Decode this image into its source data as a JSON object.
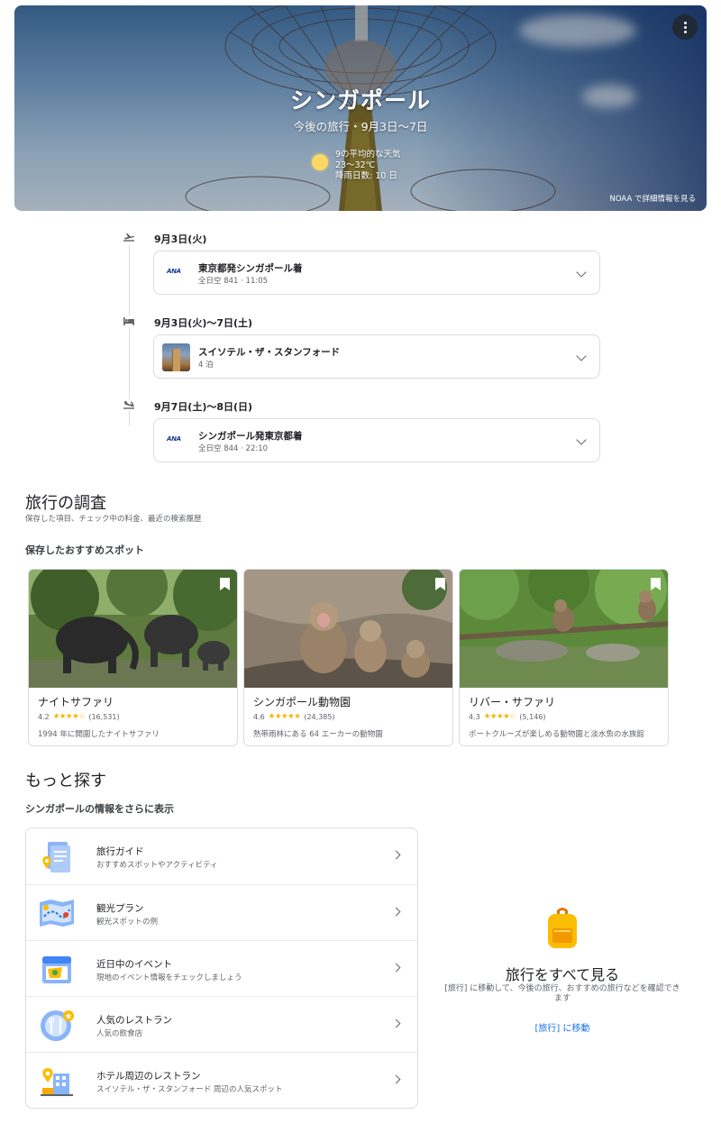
{
  "hero": {
    "title": "シンガポール",
    "subtitle": "今後の旅行・9月3日〜7日",
    "weather": {
      "line1": "9の平均的な天気",
      "line2": "23〜32℃",
      "line3": "降雨日数: 10 日"
    },
    "noaa_link": "NOAA で詳細情報を見る",
    "menu_icon": "more-vert-icon"
  },
  "itinerary": [
    {
      "icon": "flight-takeoff-icon",
      "date": "9月3日(火)",
      "card": {
        "logo": "ANA",
        "title": "東京都発シンガポール着",
        "subtitle": "全日空 841 · 11:05"
      }
    },
    {
      "icon": "hotel-icon",
      "date": "9月3日(火)〜7日(土)",
      "card": {
        "title": "スイソテル・ザ・スタンフォード",
        "subtitle": "4 泊"
      }
    },
    {
      "icon": "flight-land-icon",
      "date": "9月7日(土)〜8日(日)",
      "card": {
        "logo": "ANA",
        "title": "シンガポール発東京都着",
        "subtitle": "全日空 844 · 22:10"
      }
    }
  ],
  "research": {
    "title": "旅行の調査",
    "subtitle": "保存した項目、チェック中の料金、最近の検索履歴",
    "saved_heading": "保存したおすすめスポット",
    "spots": [
      {
        "name": "ナイトサファリ",
        "rating": "4.2",
        "stars": "★★★★☆",
        "reviews": "(16,531)",
        "desc": "1994 年に開園したナイトサファリ"
      },
      {
        "name": "シンガポール動物園",
        "rating": "4.6",
        "stars": "★★★★★",
        "reviews": "(24,385)",
        "desc": "熱帯雨林にある 64 エーカーの動物園"
      },
      {
        "name": "リバー・サファリ",
        "rating": "4.3",
        "stars": "★★★★☆",
        "reviews": "(5,146)",
        "desc": "ボートクルーズが楽しめる動物園と淡水魚の水族館"
      }
    ]
  },
  "explore": {
    "title": "もっと探す",
    "subtitle": "シンガポールの情報をさらに表示",
    "items": [
      {
        "icon": "travel-guide-icon",
        "title": "旅行ガイド",
        "subtitle": "おすすめスポットやアクティビティ"
      },
      {
        "icon": "sightseeing-plan-icon",
        "title": "観光プラン",
        "subtitle": "観光スポットの例"
      },
      {
        "icon": "events-icon",
        "title": "近日中のイベント",
        "subtitle": "現地のイベント情報をチェックしましょう"
      },
      {
        "icon": "restaurant-icon",
        "title": "人気のレストラン",
        "subtitle": "人気の飲食店"
      },
      {
        "icon": "hotel-restaurant-icon",
        "title": "ホテル周辺のレストラン",
        "subtitle": "スイソテル・ザ・スタンフォード 周辺の人気スポット"
      }
    ]
  },
  "all_trips": {
    "icon": "luggage-icon",
    "title": "旅行をすべて見る",
    "desc": "[旅行] に移動して、今後の旅行、おすすめの旅行などを確認できます",
    "link": "[旅行] に移動"
  },
  "colors": {
    "link": "#1a73e8",
    "star": "#f4b400",
    "border": "#dadce0"
  }
}
